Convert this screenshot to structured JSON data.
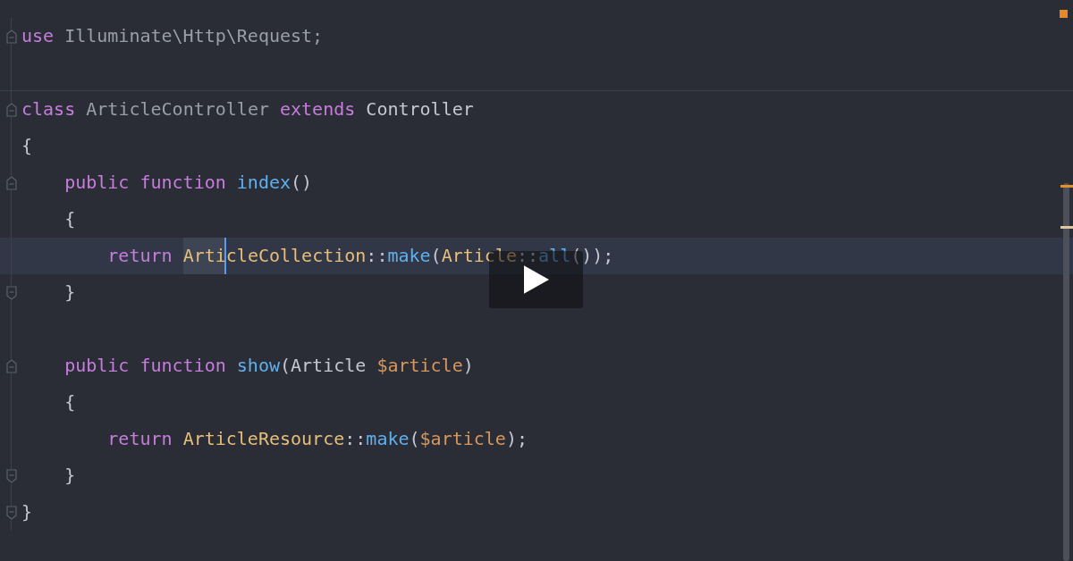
{
  "editor": {
    "lines": [
      {
        "kind": "foldstart",
        "tokens": [
          {
            "text": "use",
            "kind": "keyword"
          },
          {
            "text": " Illuminate\\Http\\Request;",
            "kind": "dim"
          }
        ]
      },
      {
        "kind": "separator"
      },
      {
        "kind": "foldstart",
        "tokens": [
          {
            "text": "class",
            "kind": "keyword"
          },
          {
            "text": " ArticleController ",
            "kind": "dim"
          },
          {
            "text": "extends",
            "kind": "keyword"
          },
          {
            "text": " Controller",
            "kind": "plain"
          }
        ]
      },
      {
        "kind": "code",
        "tokens": [
          {
            "text": "{",
            "kind": "plain"
          }
        ]
      },
      {
        "kind": "foldstart",
        "tokens": [
          {
            "text": "    public function ",
            "kind": "keyword"
          },
          {
            "text": "index",
            "kind": "func"
          },
          {
            "text": "()",
            "kind": "plain"
          }
        ]
      },
      {
        "kind": "code",
        "tokens": [
          {
            "text": "    {",
            "kind": "plain"
          }
        ]
      },
      {
        "kind": "current",
        "tokens": [
          {
            "text": "        return ",
            "kind": "keyword"
          },
          {
            "text": "Arti",
            "kind": "class",
            "selected": true
          },
          {
            "text": "cleCollection",
            "kind": "class",
            "selected": false
          },
          {
            "text": "::",
            "kind": "plain"
          },
          {
            "text": "make",
            "kind": "func"
          },
          {
            "text": "(",
            "kind": "plain"
          },
          {
            "text": "Article",
            "kind": "class",
            "selected": false
          },
          {
            "text": "::",
            "kind": "plain"
          },
          {
            "text": "all",
            "kind": "func"
          },
          {
            "text": "());",
            "kind": "plain"
          }
        ]
      },
      {
        "kind": "foldend",
        "tokens": [
          {
            "text": "    }",
            "kind": "plain"
          }
        ]
      },
      {
        "kind": "blank"
      },
      {
        "kind": "foldstart",
        "tokens": [
          {
            "text": "    public function ",
            "kind": "keyword"
          },
          {
            "text": "show",
            "kind": "func"
          },
          {
            "text": "(Article ",
            "kind": "plain"
          },
          {
            "text": "$article",
            "kind": "var"
          },
          {
            "text": ")",
            "kind": "plain"
          }
        ]
      },
      {
        "kind": "code",
        "tokens": [
          {
            "text": "    {",
            "kind": "plain"
          }
        ]
      },
      {
        "kind": "code",
        "tokens": [
          {
            "text": "        return ",
            "kind": "keyword"
          },
          {
            "text": "ArticleResource",
            "kind": "class"
          },
          {
            "text": "::",
            "kind": "plain"
          },
          {
            "text": "make",
            "kind": "func"
          },
          {
            "text": "(",
            "kind": "plain"
          },
          {
            "text": "$article",
            "kind": "var"
          },
          {
            "text": ");",
            "kind": "plain"
          }
        ]
      },
      {
        "kind": "foldend",
        "tokens": [
          {
            "text": "    }",
            "kind": "plain"
          }
        ]
      },
      {
        "kind": "foldend",
        "tokens": [
          {
            "text": "}",
            "kind": "plain"
          }
        ]
      }
    ]
  },
  "player": {
    "play_button": true
  }
}
